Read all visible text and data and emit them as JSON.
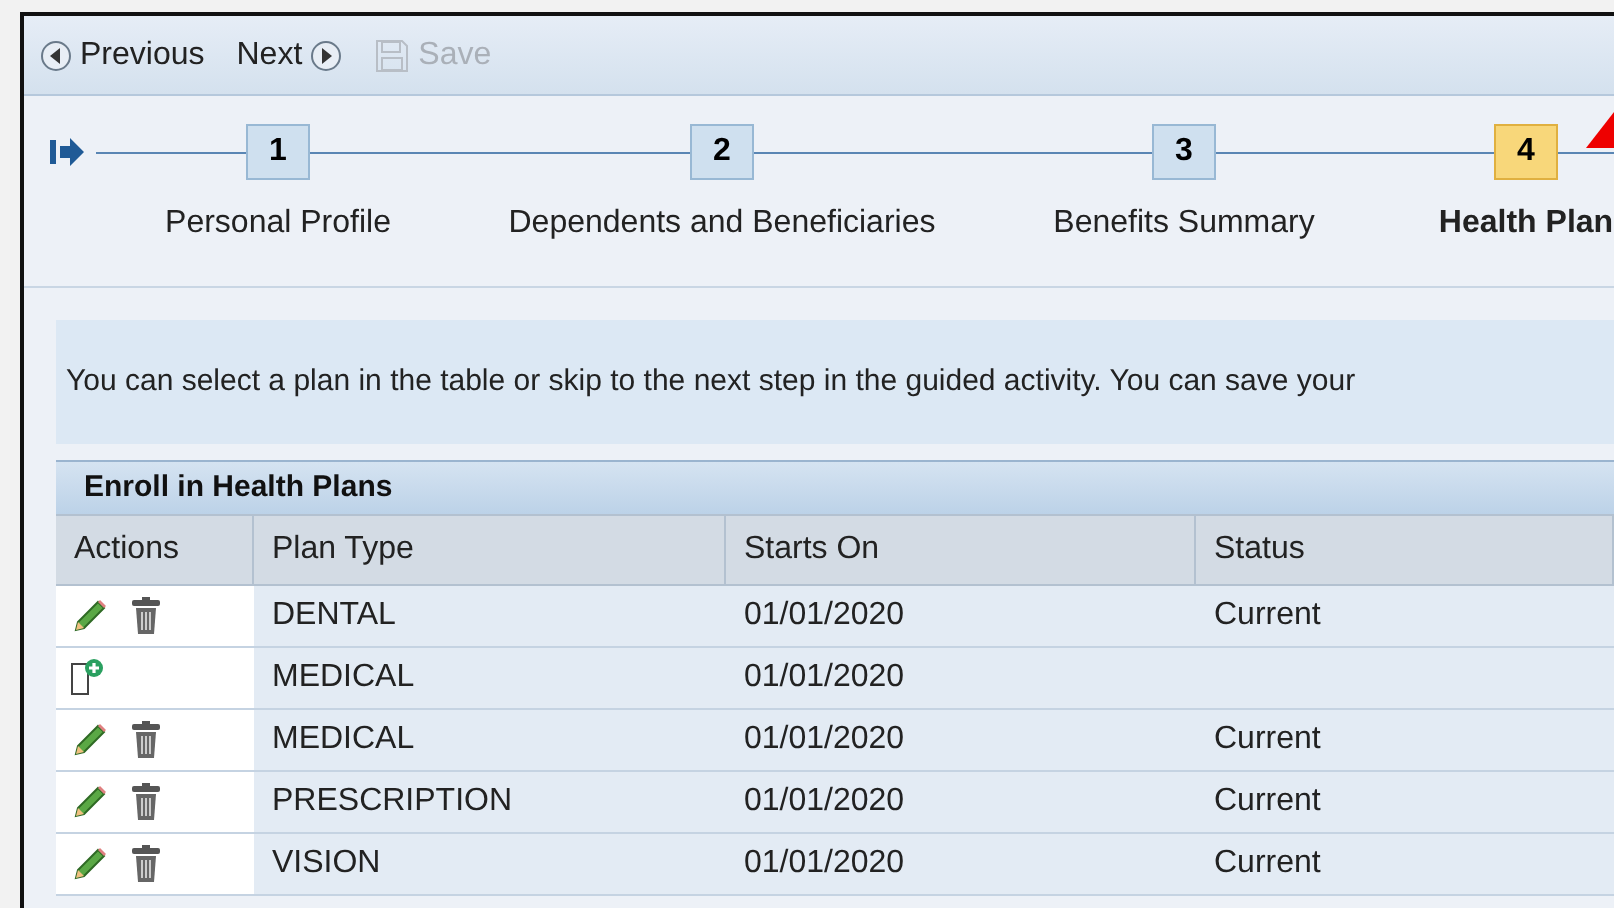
{
  "toolbar": {
    "previous": "Previous",
    "next": "Next",
    "save": "Save",
    "save_disabled": true
  },
  "steps": [
    {
      "number": "1",
      "label": "Personal Profile",
      "selected": false
    },
    {
      "number": "2",
      "label": "Dependents and Beneficiaries",
      "selected": false
    },
    {
      "number": "3",
      "label": "Benefits Summary",
      "selected": false
    },
    {
      "number": "4",
      "label": "Health Plan",
      "selected": true
    }
  ],
  "info": "You can select a plan in the table or skip to the next step in the guided activity. You can save your",
  "table": {
    "title": "Enroll in Health Plans",
    "columns": [
      "Actions",
      "Plan Type",
      "Starts On",
      "Status"
    ],
    "rows": [
      {
        "kind": "edit",
        "plan_type": "DENTAL",
        "starts_on": "01/01/2020",
        "status": "Current"
      },
      {
        "kind": "add",
        "plan_type": "MEDICAL",
        "starts_on": "01/01/2020"
      },
      {
        "kind": "edit",
        "plan_type": "MEDICAL",
        "starts_on": "01/01/2020",
        "status": "Current"
      },
      {
        "kind": "edit",
        "plan_type": "PRESCRIPTION",
        "starts_on": "01/01/2020",
        "status": "Current"
      },
      {
        "kind": "edit",
        "plan_type": "VISION",
        "starts_on": "01/01/2020",
        "status": "Current"
      }
    ]
  }
}
